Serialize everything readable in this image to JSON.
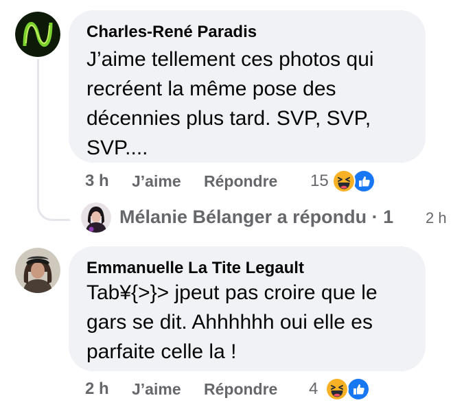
{
  "comments": [
    {
      "author": "Charles-René Paradis",
      "text": "J’aime tellement ces photos qui\nrecréent la même pose des\ndécennies plus tard. SVP, SVP,\nSVP....",
      "time": "3 h",
      "like_label": "J’aime",
      "reply_label": "Répondre",
      "reaction_count": "15",
      "reactions": [
        "haha-icon",
        "like-icon"
      ],
      "replies": {
        "replier": "Mélanie Bélanger a répondu",
        "separator": "·",
        "count": "1",
        "time": "2 h"
      }
    },
    {
      "author": "Emmanuelle La Tite Legault",
      "text": "Tab¥{>}> jpeut pas croire que le\ngars se dit. Ahhhhhh oui elle es\nparfaite celle la !",
      "time": "2 h",
      "like_label": "J’aime",
      "reply_label": "Répondre",
      "reaction_count": "4",
      "reactions": [
        "haha-icon",
        "like-icon"
      ]
    }
  ],
  "colors": {
    "bubble": "#f0f2f5",
    "meta_text": "#65676b",
    "like_blue": "#1877f2",
    "haha_yellow": "#f7b125"
  }
}
